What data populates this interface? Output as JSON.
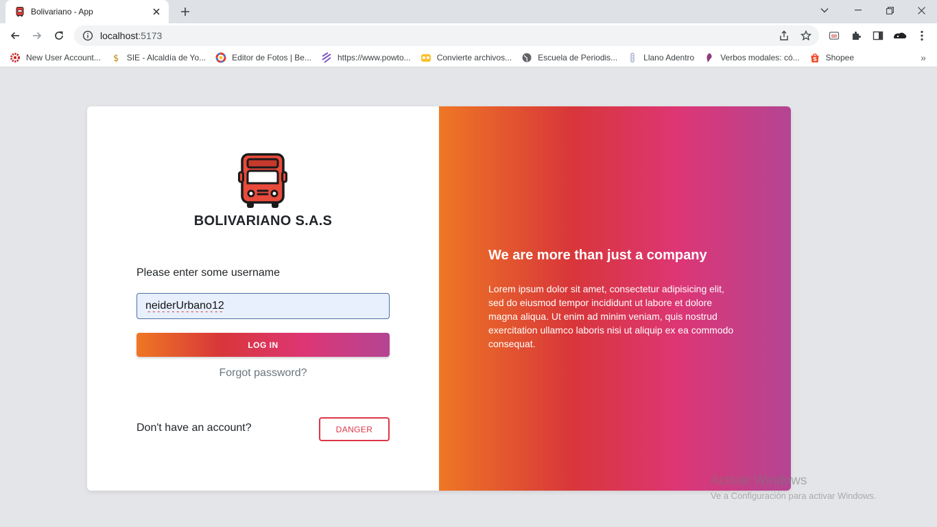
{
  "browser": {
    "tab": {
      "title": "Bolivariano - App"
    },
    "address": {
      "host": "localhost",
      "port": ":5173"
    },
    "bookmarks": [
      {
        "label": "New User Account...",
        "icon": "gear-red-icon"
      },
      {
        "label": "SIE - Alcaldía de Yo...",
        "icon": "dollar-icon"
      },
      {
        "label": "Editor de Fotos | Be...",
        "icon": "color-wheel-icon"
      },
      {
        "label": "https://www.powto...",
        "icon": "powtoon-icon"
      },
      {
        "label": "Convierte archivos...",
        "icon": "convert-icon"
      },
      {
        "label": "Escuela de Periodis...",
        "icon": "globe-icon"
      },
      {
        "label": "Llano Adentro",
        "icon": "sound-icon"
      },
      {
        "label": "Verbos modales: có...",
        "icon": "purple-leaf-icon"
      },
      {
        "label": "Shopee",
        "icon": "shopee-icon"
      }
    ]
  },
  "login": {
    "brand": "BOLIVARIANO S.A.S",
    "prompt": "Please enter some username",
    "username_value": "neiderUrbano12",
    "login_label": "LOG IN",
    "forgot_label": "Forgot password?",
    "no_account_label": "Don't have an account?",
    "danger_label": "DANGER"
  },
  "promo": {
    "heading": "We are more than just a company",
    "body": "Lorem ipsum dolor sit amet, consectetur adipisicing elit, sed do eiusmod tempor incididunt ut labore et dolore magna aliqua. Ut enim ad minim veniam, quis nostrud exercitation ullamco laboris nisi ut aliquip ex ea commodo consequat."
  },
  "watermark": {
    "line1": "Activar Windows",
    "line2": "Ve a Configuración para activar Windows."
  },
  "colors": {
    "gradient": [
      "#ee7724",
      "#d8363a",
      "#dd3675",
      "#b44593"
    ],
    "danger": "#dc3545"
  }
}
